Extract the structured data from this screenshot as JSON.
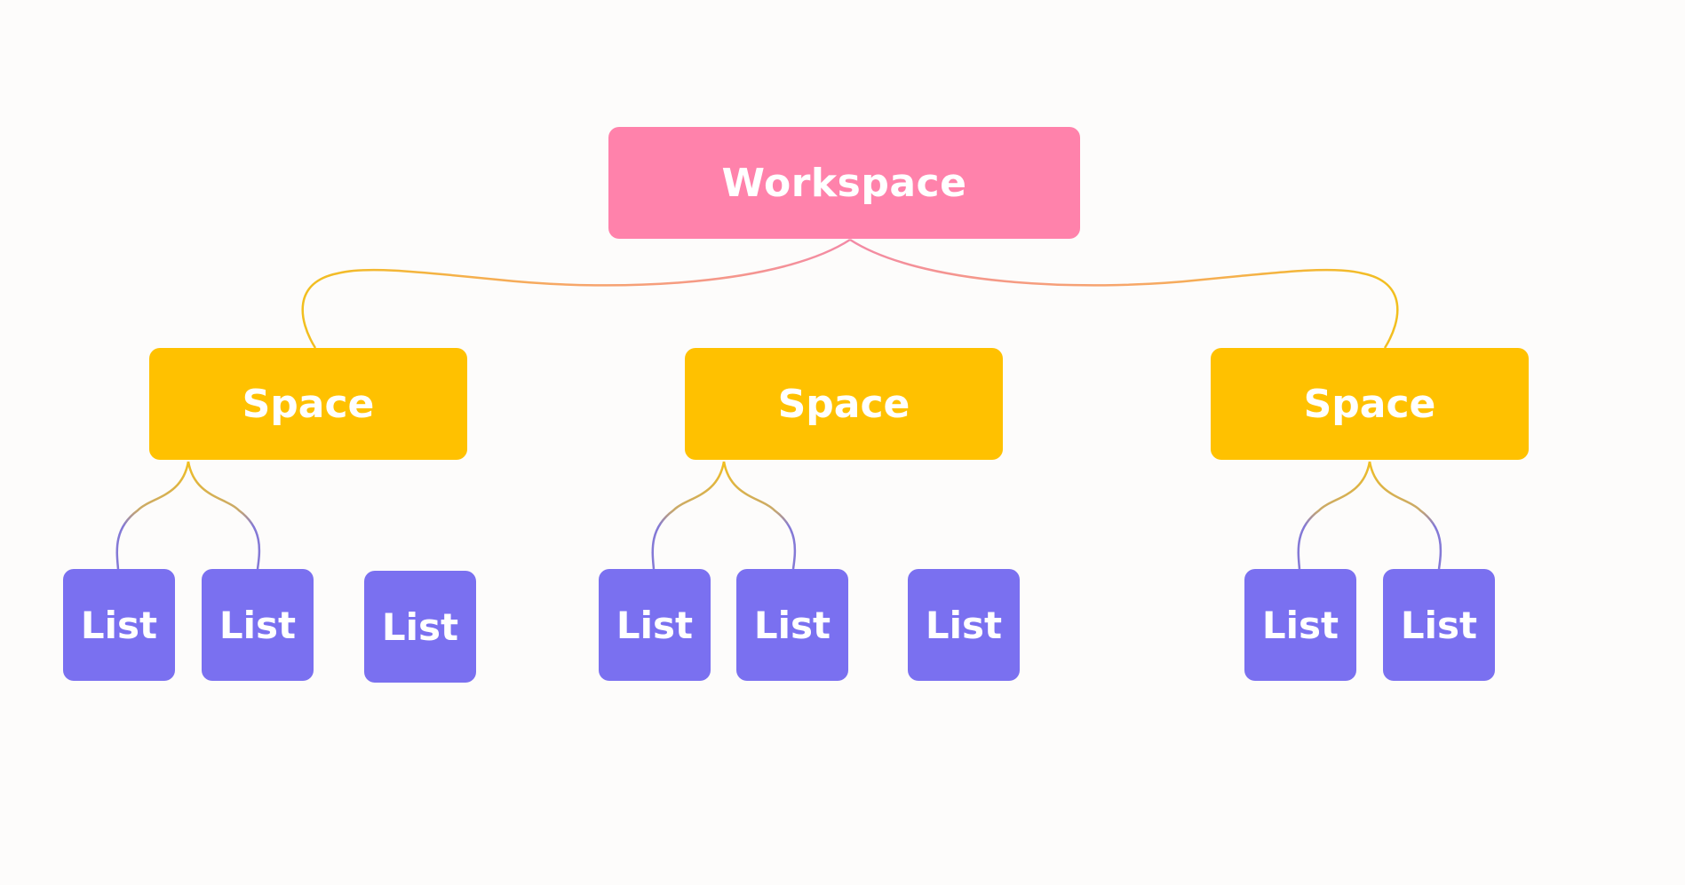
{
  "diagram": {
    "root": {
      "label": "Workspace",
      "color": "#ff82ab"
    },
    "spaces": [
      {
        "label": "Space",
        "color": "#ffc100",
        "lists": [
          "List",
          "List",
          "List"
        ]
      },
      {
        "label": "Space",
        "color": "#ffc100",
        "lists": [
          "List",
          "List",
          "List"
        ]
      },
      {
        "label": "Space",
        "color": "#ffc100",
        "lists": [
          "List",
          "List"
        ]
      }
    ],
    "list_color": "#7a70f0",
    "connector_colors": {
      "pink": "#f38aa6",
      "yellow": "#f2bf1e",
      "purple": "#8479d6"
    }
  }
}
